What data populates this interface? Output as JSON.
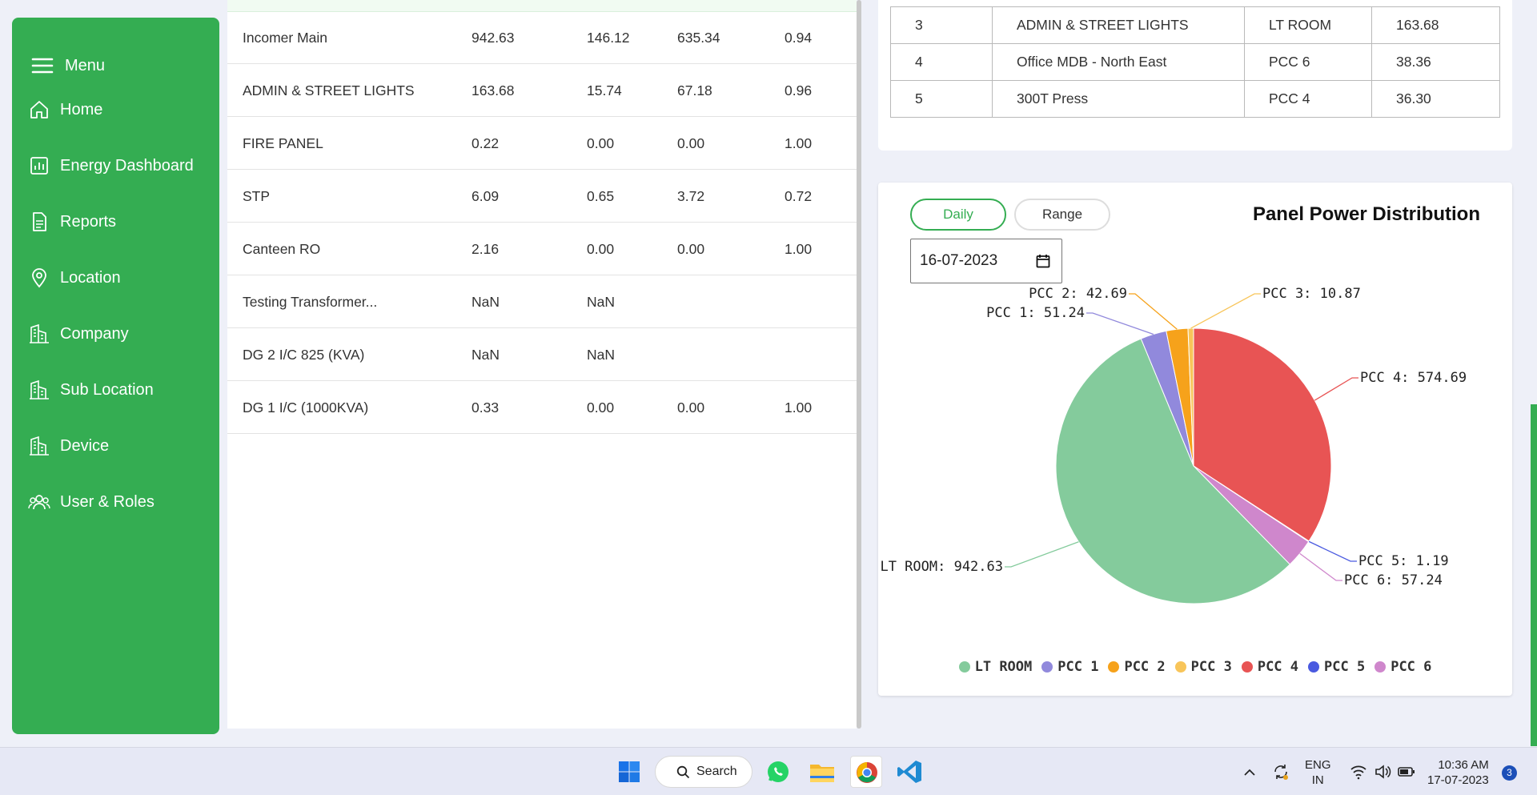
{
  "sidebar": {
    "menu_label": "Menu",
    "items": [
      {
        "label": "Home",
        "icon": "home-icon"
      },
      {
        "label": "Energy Dashboard",
        "icon": "bar-chart-icon"
      },
      {
        "label": "Reports",
        "icon": "document-icon"
      },
      {
        "label": "Location",
        "icon": "map-pin-icon"
      },
      {
        "label": "Company",
        "icon": "buildings-icon"
      },
      {
        "label": "Sub Location",
        "icon": "buildings-icon"
      },
      {
        "label": "Device",
        "icon": "buildings-icon"
      },
      {
        "label": "User & Roles",
        "icon": "users-icon"
      }
    ],
    "color": "#34ad52"
  },
  "left_table": {
    "rows": [
      [
        "Incomer Main",
        "942.63",
        "146.12",
        "635.34",
        "0.94"
      ],
      [
        "ADMIN & STREET LIGHTS",
        "163.68",
        "15.74",
        "67.18",
        "0.96"
      ],
      [
        "FIRE PANEL",
        "0.22",
        "0.00",
        "0.00",
        "1.00"
      ],
      [
        "STP",
        "6.09",
        "0.65",
        "3.72",
        "0.72"
      ],
      [
        "Canteen RO",
        "2.16",
        "0.00",
        "0.00",
        "1.00"
      ],
      [
        "Testing Transformer...",
        "NaN",
        "NaN",
        "",
        ""
      ],
      [
        "DG 2 I/C 825 (KVA)",
        "NaN",
        "NaN",
        "",
        ""
      ],
      [
        "DG 1 I/C (1000KVA)",
        "0.33",
        "0.00",
        "0.00",
        "1.00"
      ]
    ]
  },
  "top_table": {
    "rows": [
      [
        "3",
        "ADMIN & STREET LIGHTS",
        "LT ROOM",
        "163.68"
      ],
      [
        "4",
        "Office MDB - North East",
        "PCC 6",
        "38.36"
      ],
      [
        "5",
        "300T Press",
        "PCC 4",
        "36.30"
      ]
    ]
  },
  "chart_panel": {
    "daily_label": "Daily",
    "range_label": "Range",
    "title": "Panel Power Distribution",
    "date_value": "16-07-2023"
  },
  "chart_data": {
    "type": "pie",
    "title": "Panel Power Distribution",
    "slices": [
      {
        "label": "LT ROOM",
        "value": 942.63,
        "color": "#84cb9c"
      },
      {
        "label": "PCC 1",
        "value": 51.24,
        "color": "#9189dc"
      },
      {
        "label": "PCC 2",
        "value": 42.69,
        "color": "#f6a21b"
      },
      {
        "label": "PCC 3",
        "value": 10.87,
        "color": "#f8c55a"
      },
      {
        "label": "PCC 4",
        "value": 574.69,
        "color": "#e85454"
      },
      {
        "label": "PCC 5",
        "value": 1.19,
        "color": "#4a5ae0"
      },
      {
        "label": "PCC 6",
        "value": 57.24,
        "color": "#cf87cc"
      }
    ],
    "slice_labels": [
      "LT ROOM: 942.63",
      "PCC 1: 51.24",
      "PCC 2: 42.69",
      "PCC 3: 10.87",
      "PCC 4: 574.69",
      "PCC 5: 1.19",
      "PCC 6: 57.24"
    ],
    "legend_position": "bottom"
  },
  "taskbar": {
    "search_label": "Search",
    "lang_line1": "ENG",
    "lang_line2": "IN",
    "time": "10:36 AM",
    "date": "17-07-2023",
    "notification_count": "3"
  }
}
